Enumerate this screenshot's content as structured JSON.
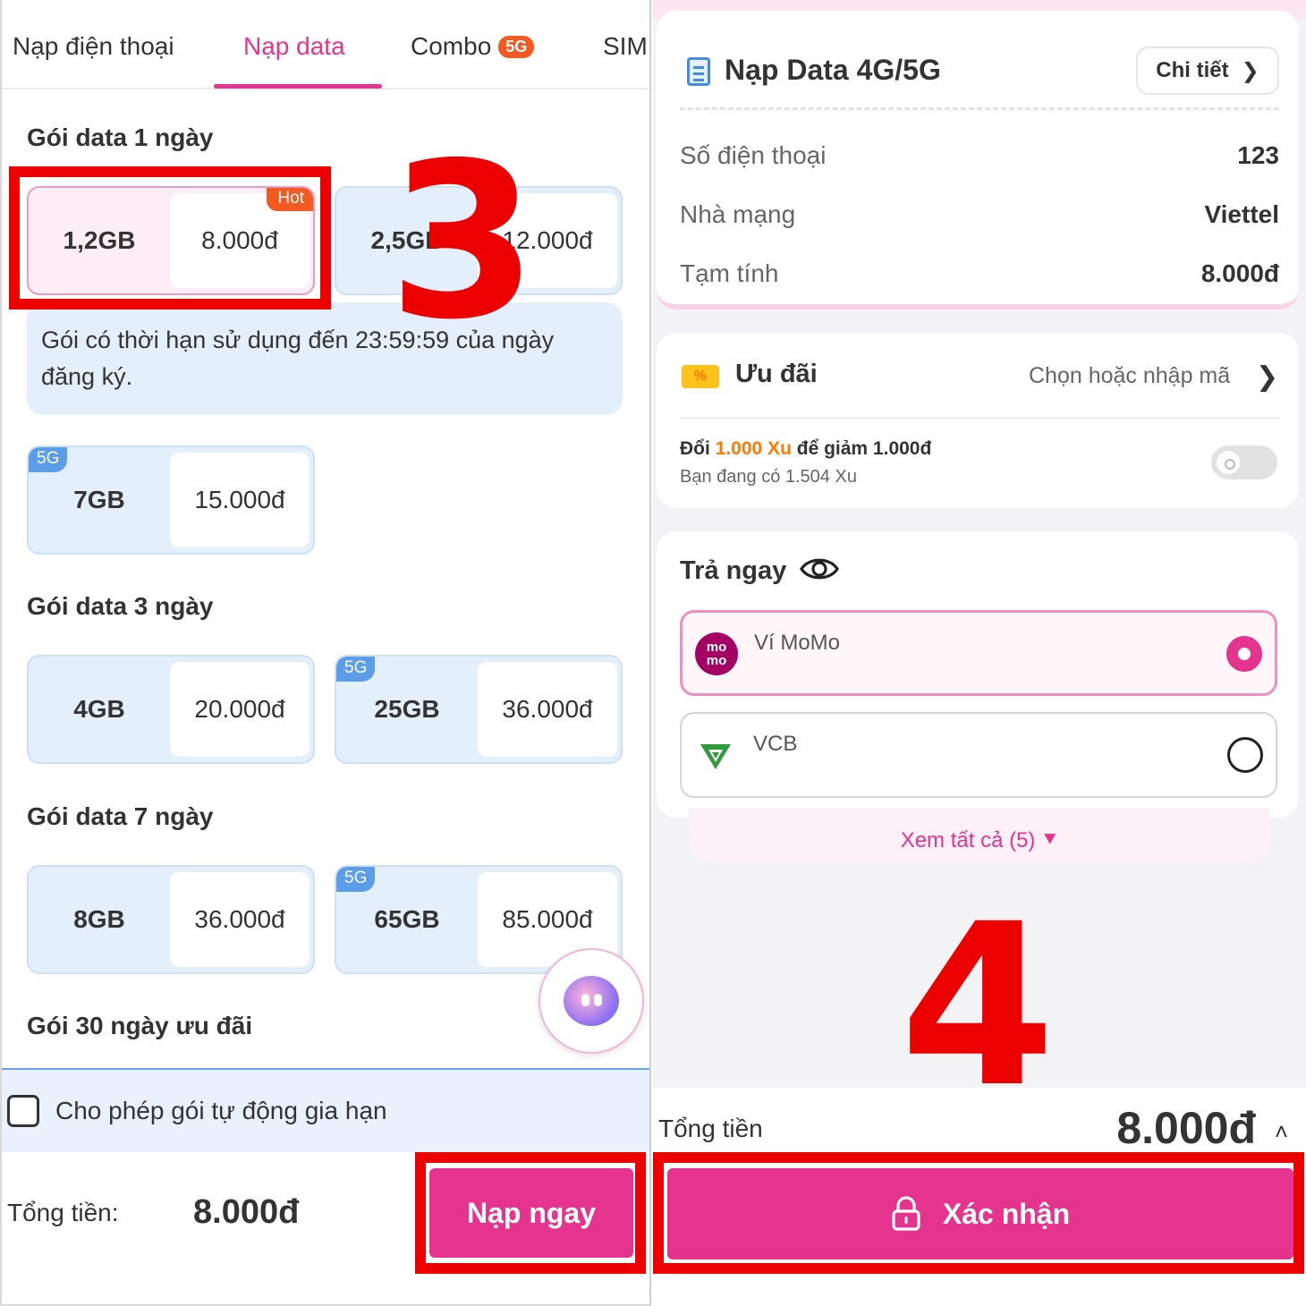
{
  "left": {
    "tabs": [
      {
        "label": "Nạp điện thoại",
        "active": false
      },
      {
        "label": "Nạp data",
        "active": true
      },
      {
        "label": "Combo",
        "badge": "5G",
        "active": false
      },
      {
        "label": "SIM",
        "active": false
      }
    ],
    "sections": {
      "one_day": "Gói data 1 ngày",
      "three_day": "Gói data 3 ngày",
      "seven_day": "Gói data 7 ngày",
      "thirty_day": "Gói 30 ngày ưu đãi"
    },
    "packages": {
      "p1": {
        "data": "1,2GB",
        "price": "8.000đ",
        "tag": "Hot",
        "selected": true
      },
      "p2": {
        "data": "2,5GB",
        "price": "12.000đ"
      },
      "p3": {
        "data": "7GB",
        "price": "15.000đ",
        "tag": "5G"
      },
      "p4": {
        "data": "4GB",
        "price": "20.000đ"
      },
      "p5": {
        "data": "25GB",
        "price": "36.000đ",
        "tag": "5G"
      },
      "p6": {
        "data": "8GB",
        "price": "36.000đ"
      },
      "p7": {
        "data": "65GB",
        "price": "85.000đ",
        "tag": "5G"
      }
    },
    "note": "Gói có thời hạn sử dụng đến 23:59:59 của ngày đăng ký.",
    "auto_renew_label": "Cho phép gói tự động gia hạn",
    "auto_renew_checked": false,
    "total_label": "Tổng tiền:",
    "total_value": "8.000đ",
    "submit_label": "Nạp ngay",
    "step_number": "3"
  },
  "right": {
    "order_title": "Nạp Data 4G/5G",
    "detail_button": "Chi tiết",
    "rows": [
      {
        "key": "Số điện thoại",
        "value": "123"
      },
      {
        "key": "Nhà mạng",
        "value": "Viettel"
      },
      {
        "key": "Tạm tính",
        "value": "8.000đ"
      }
    ],
    "promo": {
      "title": "Ưu đãi",
      "placeholder": "Chọn hoặc nhập mã",
      "xu_prefix": "Đổi ",
      "xu_amount": "1.000 Xu",
      "xu_suffix": " để giảm 1.000đ",
      "xu_balance": "Bạn đang có 1.504 Xu",
      "toggle_on": false
    },
    "payment": {
      "title": "Trả ngay",
      "options": [
        {
          "name": "Ví MoMo",
          "logo_text": "mo mo",
          "selected": true
        },
        {
          "name": "VCB",
          "selected": false
        }
      ],
      "see_all": "Xem tất cả (5)"
    },
    "total_label": "Tổng tiền",
    "total_value": "8.000đ",
    "confirm_label": "Xác nhận",
    "step_number": "4"
  },
  "colors": {
    "accent_pink": "#e6338e",
    "annotation_red": "#ec0000",
    "package_blue": "#e4effc",
    "hot_orange": "#f25a22",
    "tag_5g_blue": "#5b9de8",
    "xu_orange": "#ff7a00"
  },
  "icons": [
    "receipt-icon",
    "chevron-right-icon",
    "coupon-icon",
    "eye-icon",
    "momo-logo",
    "vcb-logo",
    "lock-icon",
    "chevron-up-icon",
    "double-chevron-down-icon",
    "chatbot-icon"
  ]
}
